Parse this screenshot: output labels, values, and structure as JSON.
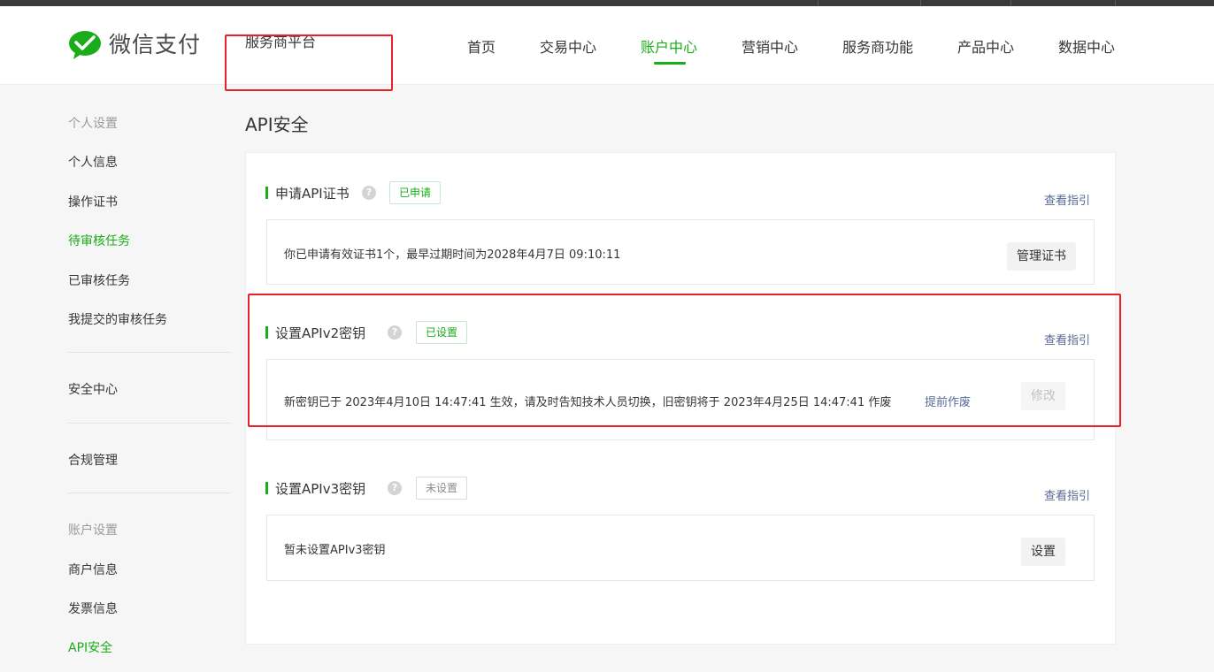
{
  "header": {
    "logo_text": "微信支付",
    "platform": "服务商平台",
    "nav": [
      {
        "label": "首页"
      },
      {
        "label": "交易中心"
      },
      {
        "label": "账户中心",
        "active": true
      },
      {
        "label": "营销中心"
      },
      {
        "label": "服务商功能"
      },
      {
        "label": "产品中心"
      },
      {
        "label": "数据中心"
      }
    ]
  },
  "sidebar": {
    "items": [
      {
        "label": "个人设置",
        "type": "group"
      },
      {
        "label": "个人信息"
      },
      {
        "label": "操作证书"
      },
      {
        "label": "待审核任务",
        "active": true
      },
      {
        "label": "已审核任务"
      },
      {
        "label": "我提交的审核任务"
      },
      {
        "label": "安全中心"
      },
      {
        "label": "合规管理"
      },
      {
        "label": "账户设置",
        "type": "group"
      },
      {
        "label": "商户信息"
      },
      {
        "label": "发票信息"
      },
      {
        "label": "API安全",
        "active": true
      }
    ]
  },
  "main": {
    "title": "API安全",
    "sections": [
      {
        "title": "申请API证书",
        "tag": "已申请",
        "guide": "查看指引",
        "text": "你已申请有效证书1个，最早过期时间为2028年4月7日 09:10:11",
        "button": "管理证书"
      },
      {
        "title": "设置APIv2密钥",
        "tag": "已设置",
        "guide": "查看指引",
        "text": "新密钥已于 2023年4月10日 14:47:41 生效，请及时告知技术人员切换，旧密钥将于 2023年4月25日 14:47:41 作废",
        "link": "提前作废",
        "button": "修改"
      },
      {
        "title": "设置APIv3密钥",
        "tag": "未设置",
        "guide": "查看指引",
        "text": "暂未设置APIv3密钥",
        "button": "设置"
      }
    ]
  },
  "colors": {
    "accent": "#1aad19",
    "link": "#576b95",
    "highlight": "#e8202a"
  }
}
